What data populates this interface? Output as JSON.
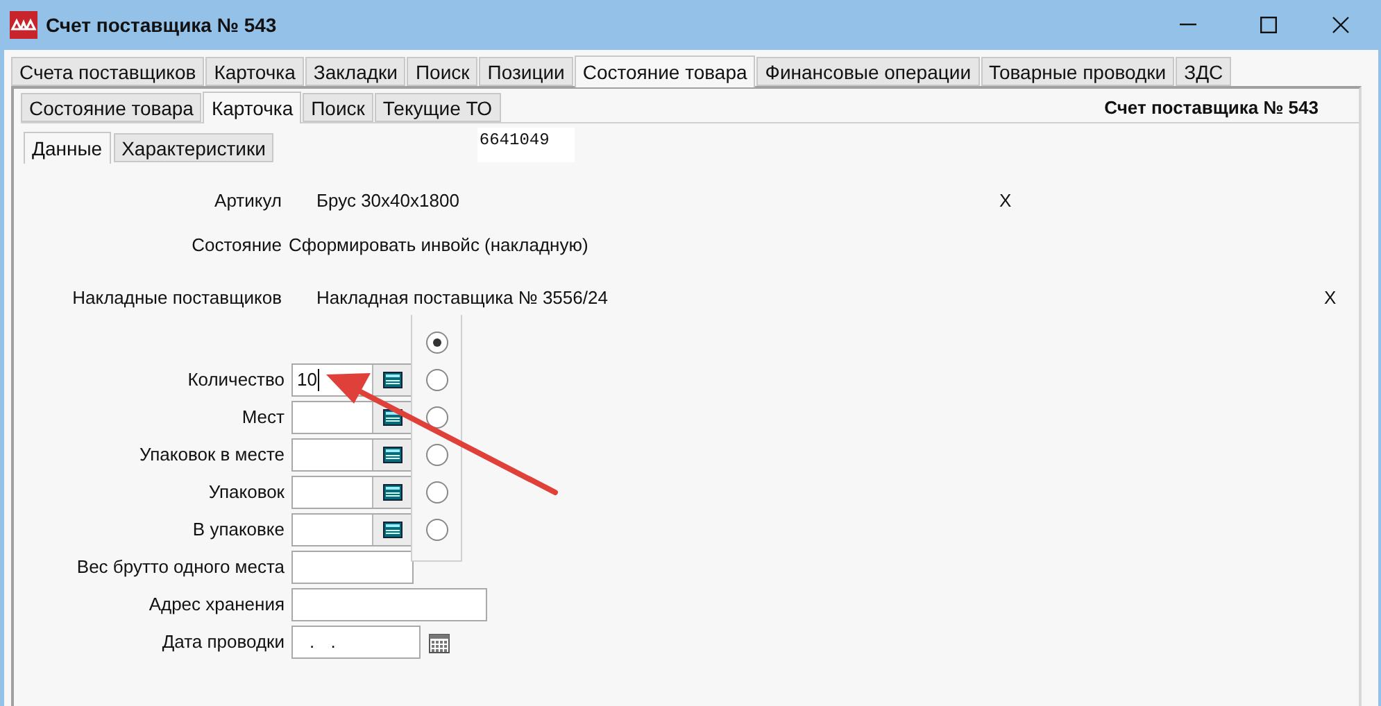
{
  "window": {
    "title": "Счет поставщика № 543"
  },
  "tabs": [
    {
      "label": "Счета поставщиков",
      "selected": false
    },
    {
      "label": "Карточка",
      "selected": false
    },
    {
      "label": "Закладки",
      "selected": false
    },
    {
      "label": "Поиск",
      "selected": false
    },
    {
      "label": "Позиции",
      "selected": false
    },
    {
      "label": "Состояние товара",
      "selected": true
    },
    {
      "label": "Финансовые операции",
      "selected": false
    },
    {
      "label": "Товарные проводки",
      "selected": false
    },
    {
      "label": "ЗДС",
      "selected": false
    }
  ],
  "inner_tabs": [
    {
      "label": "Состояние товара",
      "selected": false
    },
    {
      "label": "Карточка",
      "selected": true
    },
    {
      "label": "Поиск",
      "selected": false
    },
    {
      "label": "Текущие ТО",
      "selected": false
    }
  ],
  "header_title": "Счет поставщика № 543",
  "sub_tabs": [
    {
      "label": "Данные",
      "selected": true
    },
    {
      "label": "Характеристики",
      "selected": false
    }
  ],
  "code": "6641049",
  "info_rows": [
    {
      "label": "Артикул",
      "value": "Брус 30x40x1800",
      "clear": "X",
      "kind": "indent"
    },
    {
      "label": "Состояние",
      "value": "Сформировать инвойс (накладную)",
      "kind": "plain"
    },
    {
      "label": "Накладные поставщиков",
      "value": "Накладная поставщика № 3556/24",
      "clear": "X",
      "kind": "indent"
    }
  ],
  "form_fields": [
    {
      "label": "Количество",
      "value": "10",
      "kind": "calc"
    },
    {
      "label": "Мест",
      "kind": "calc"
    },
    {
      "label": "Упаковок в месте",
      "kind": "calc"
    },
    {
      "label": "Упаковок",
      "kind": "calc"
    },
    {
      "label": "В упаковке",
      "kind": "calc"
    },
    {
      "label": "Вес брутто одного места",
      "kind": "text"
    },
    {
      "label": "Адрес хранения",
      "kind": "wide"
    },
    {
      "label": "Дата проводки",
      "value": ". .",
      "kind": "date"
    }
  ],
  "radios": [
    {
      "selected": true
    },
    {
      "selected": false
    },
    {
      "selected": false
    },
    {
      "selected": false
    },
    {
      "selected": false
    },
    {
      "selected": false
    }
  ]
}
